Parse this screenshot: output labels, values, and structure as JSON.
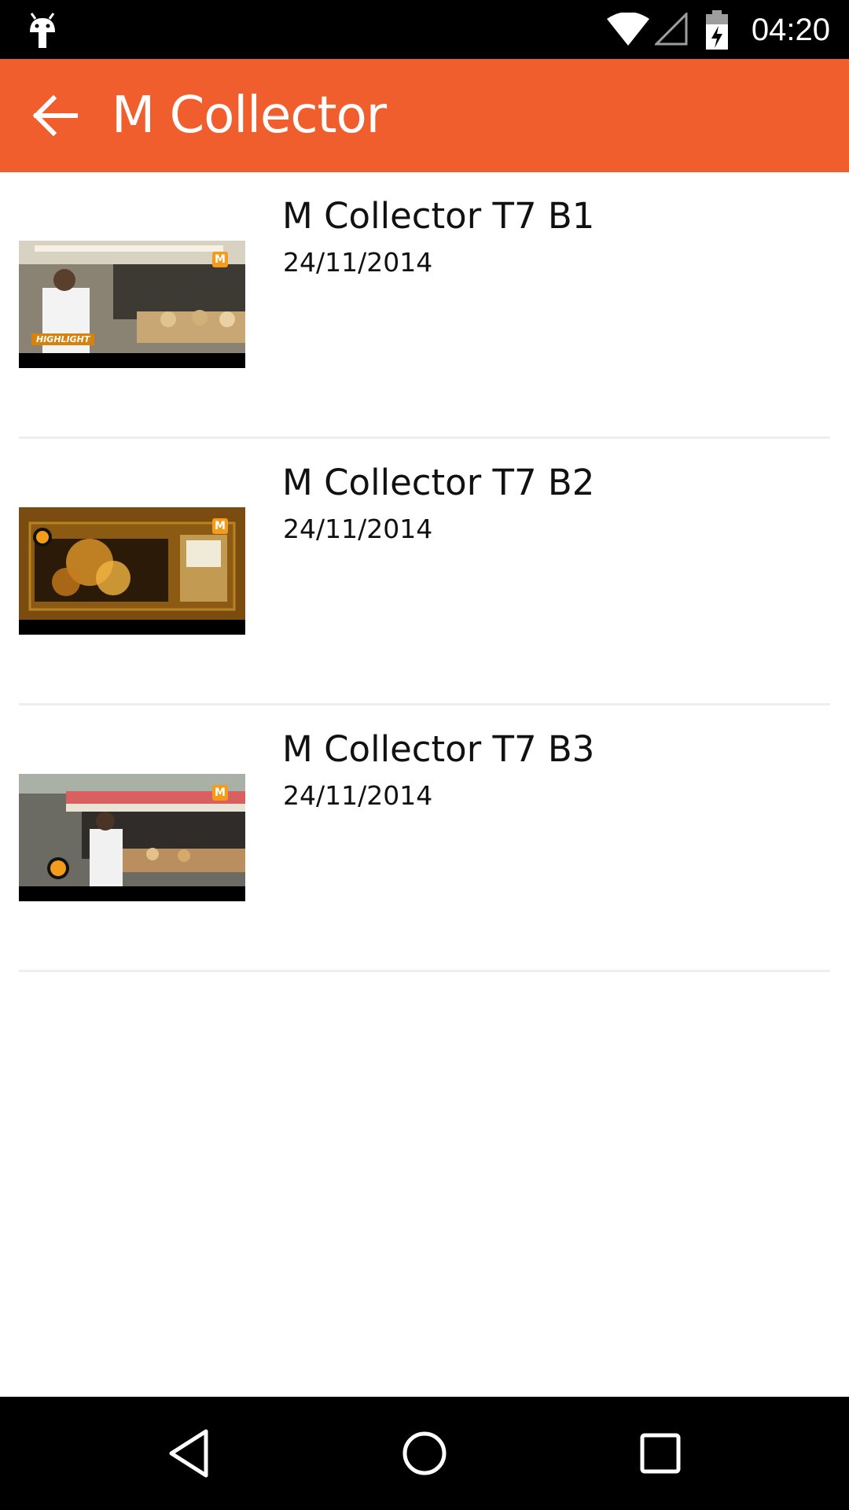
{
  "status_bar": {
    "time": "04:20",
    "icons": [
      "android-debug-icon",
      "wifi-icon",
      "signal-icon",
      "battery-charging-icon"
    ]
  },
  "app_bar": {
    "title": "M Collector",
    "back_icon": "arrow-back-icon",
    "background_color": "#f05e2e"
  },
  "videos": [
    {
      "title": "M Collector T7 B1",
      "date": "24/11/2014",
      "thumbnail_tag": "HIGHLIGHT",
      "badge": "M"
    },
    {
      "title": "M Collector T7 B2",
      "date": "24/11/2014",
      "badge": "M"
    },
    {
      "title": "M Collector T7 B3",
      "date": "24/11/2014",
      "badge": "M"
    }
  ],
  "nav_bar": {
    "buttons": [
      "back-triangle-icon",
      "home-circle-icon",
      "recents-square-icon"
    ]
  }
}
